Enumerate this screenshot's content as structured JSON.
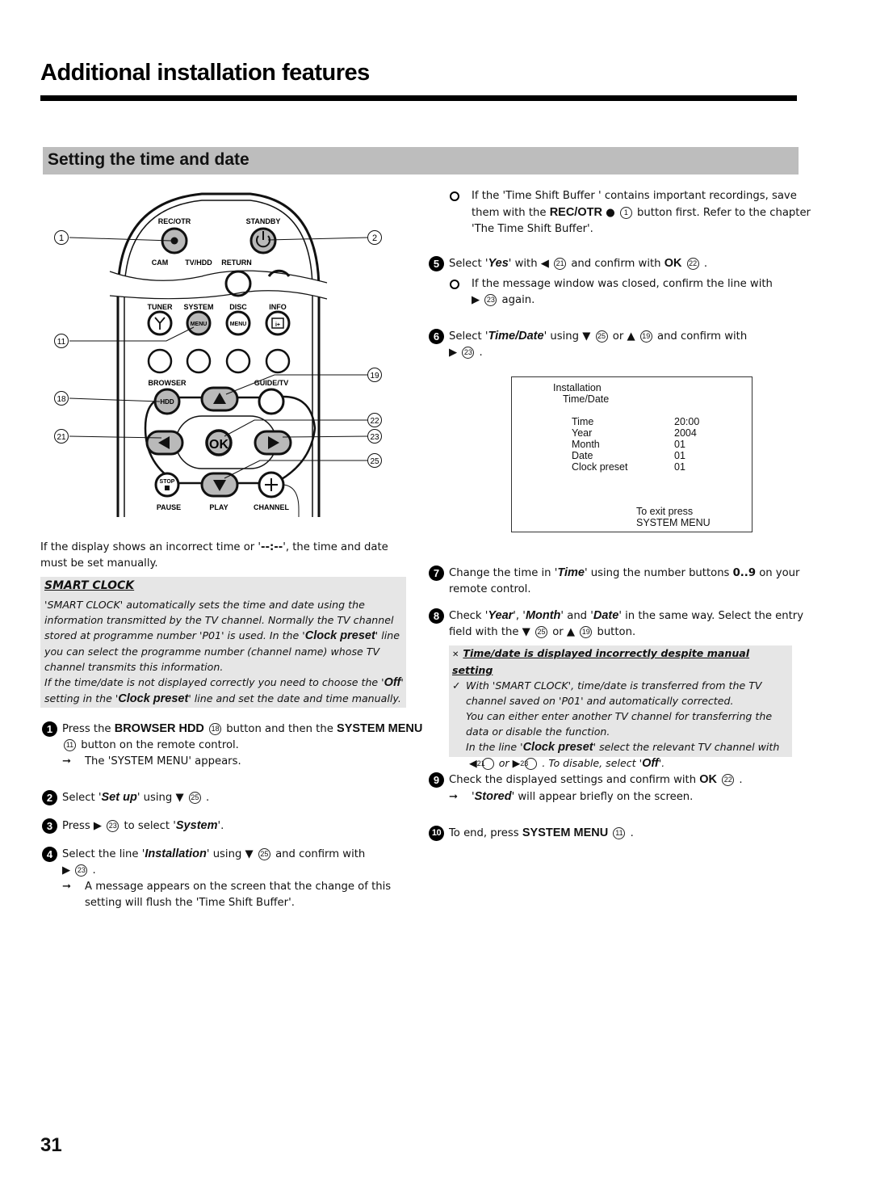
{
  "header": {
    "title": "Additional installation features",
    "section_title": "Setting the time and date"
  },
  "remote": {
    "labels": {
      "rec_otr": "REC/OTR",
      "standby": "STANDBY",
      "cam": "CAM",
      "tv_hdd": "TV/HDD",
      "return": "RETURN",
      "tuner": "TUNER",
      "system": "SYSTEM",
      "disc": "DISC",
      "info": "INFO",
      "menu1": "MENU",
      "menu2": "MENU",
      "info_icon": "i+",
      "browser": "BROWSER",
      "hdd": "HDD",
      "guide_tv": "GUIDE/TV",
      "ok": "OK",
      "stop": "STOP",
      "pause": "PAUSE",
      "play": "PLAY",
      "channel": "CHANNEL"
    },
    "callouts": [
      "1",
      "2",
      "11",
      "18",
      "19",
      "21",
      "22",
      "23",
      "25"
    ]
  },
  "intro": {
    "line_a": "If the display shows an incorrect time or '",
    "dashes": "--:--",
    "line_b": "', the time and date must be set manually."
  },
  "smart_clock": {
    "title": "SMART CLOCK",
    "p1a": "'SMART CLOCK' automatically sets the time and date using the information transmitted by the TV channel. Normally the TV channel stored at programme number 'P01' is used. In the '",
    "p1_em": "Clock preset",
    "p1b": "' line you can select the programme number (channel name) whose TV channel transmits this information.",
    "p2a": "If the time/date is not displayed correctly you need to choose the '",
    "p2_em1": "Off",
    "p2b": "' setting in the '",
    "p2_em2": "Clock preset",
    "p2c": "' line and set the date and time manually."
  },
  "steps": {
    "s1": {
      "n": "1",
      "a": "Press the ",
      "b1": "BROWSER HDD",
      "c1": "18",
      "m": " button and then the ",
      "b2": "SYSTEM MENU",
      "c2": "11",
      "e": " button on the remote control.",
      "result": "The 'SYSTEM MENU' appears."
    },
    "s2": {
      "n": "2",
      "a": "Select '",
      "em": "Set up",
      "b": "' using ",
      "c": "25",
      "e": " ."
    },
    "s3": {
      "n": "3",
      "a": "Press ",
      "c": "23",
      "b": " to select '",
      "em": "System",
      "e": "'."
    },
    "s4": {
      "n": "4",
      "a": "Select the line '",
      "em": "Installation",
      "b": "' using ",
      "c1": "25",
      "m": " and confirm with",
      "c2": "23",
      "e": " .",
      "result": "A message appears on the screen that the change of this setting will flush the 'Time Shift Buffer'."
    },
    "note_tsb": {
      "a": "If the 'Time Shift Buffer ' contains important recordings, save them with the ",
      "b": "REC/OTR",
      "c": "1",
      "e": " button first. Refer to the chapter 'The Time Shift Buffer'."
    },
    "s5": {
      "n": "5",
      "a": "Select '",
      "em": "Yes",
      "b": "' with ",
      "c1": "21",
      "m": " and confirm with ",
      "ok": "OK",
      "c2": "22",
      "e": " .",
      "note_a": "If the message window was closed, confirm the line with",
      "note_c": "23",
      "note_e": " again."
    },
    "s6": {
      "n": "6",
      "a": "Select '",
      "em": "Time/Date",
      "b": "' using ",
      "c1": "25",
      "or": " or ",
      "c2": "19",
      "m": " and confirm with",
      "c3": "23",
      "e": " ."
    },
    "s7": {
      "n": "7",
      "a": "Change the time in '",
      "em": "Time",
      "b": "' using the number buttons ",
      "bold": "0..9",
      "e": " on your remote control."
    },
    "s8": {
      "n": "8",
      "a": "Check '",
      "em1": "Year",
      "m1": "', '",
      "em2": "Month",
      "m2": "' and '",
      "em3": "Date",
      "b": "' in the same way. Select the entry field with the ",
      "c1": "25",
      "or": " or ",
      "c2": "19",
      "e": " button."
    },
    "s9": {
      "n": "9",
      "a": "Check the displayed settings and confirm with ",
      "ok": "OK",
      "c": "22",
      "e": " .",
      "result_em": "Stored",
      "result": " will appear briefly on the screen."
    },
    "s10": {
      "n": "10",
      "a": "To end, press ",
      "b": "SYSTEM MENU",
      "c": "11",
      "e": " ."
    }
  },
  "osd": {
    "title": "Installation",
    "subtitle": "Time/Date",
    "rows": [
      {
        "label": "Time",
        "value": "20:00"
      },
      {
        "label": "Year",
        "value": "2004"
      },
      {
        "label": "Month",
        "value": "01"
      },
      {
        "label": "Date",
        "value": "01"
      },
      {
        "label": "Clock preset",
        "value": "01"
      }
    ],
    "exit_1": "To exit press",
    "exit_2": "SYSTEM MENU"
  },
  "tip": {
    "problem": "Time/date is displayed incorrectly despite manual setting",
    "s1": "With 'SMART CLOCK', time/date is transferred from the TV channel saved on 'P01' and automatically corrected.",
    "s2": "You can either enter another TV channel for transferring the data or disable the function.",
    "s3a": "In the line '",
    "s3_em": "Clock preset",
    "s3b": "' select the relevant TV channel with",
    "c1": "21",
    "or": " or ",
    "c2": "23",
    "s4": " . To disable, select '",
    "s4_em": "Off",
    "s4e": "'."
  },
  "footer": {
    "page_number": "31"
  }
}
